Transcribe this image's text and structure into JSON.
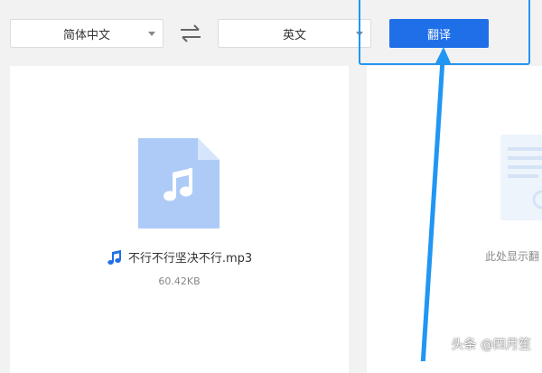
{
  "toolbar": {
    "source_language": "简体中文",
    "target_language": "英文",
    "translate_label": "翻译"
  },
  "file": {
    "icon": "music-file-icon",
    "name": "不行不行坚决不行.mp3",
    "size": "60.42KB"
  },
  "result_panel": {
    "placeholder_text": "此处显示翻"
  },
  "watermark": "头条 @四月笙",
  "colors": {
    "accent": "#1f6fe8",
    "annotation": "#2196f3",
    "file_icon": "#aecbf7"
  }
}
